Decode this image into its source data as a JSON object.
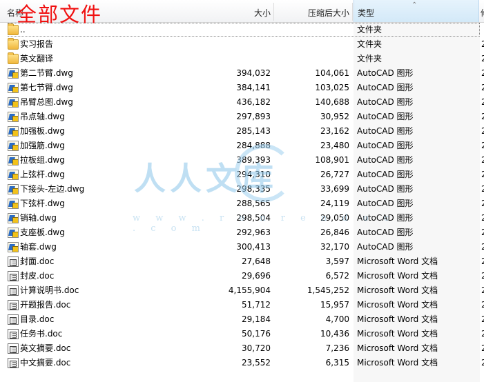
{
  "overlay_title": "全部文件",
  "columns": {
    "name": "名称",
    "size": "大小",
    "packed": "压缩后大小",
    "type": "类型",
    "more": "修"
  },
  "watermark": {
    "text": "人人文库",
    "url": "w w w . r e n r e n d o c . c o m"
  },
  "rows": [
    {
      "icon": "folder",
      "name": "..",
      "size": "",
      "packed": "",
      "type": "文件夹",
      "more": ""
    },
    {
      "icon": "folder",
      "name": "实习报告",
      "size": "",
      "packed": "",
      "type": "文件夹",
      "more": "2"
    },
    {
      "icon": "folder",
      "name": "英文翻译",
      "size": "",
      "packed": "",
      "type": "文件夹",
      "more": "2"
    },
    {
      "icon": "dwg",
      "name": "第二节臂.dwg",
      "size": "394,032",
      "packed": "104,061",
      "type": "AutoCAD 图形",
      "more": "2"
    },
    {
      "icon": "dwg",
      "name": "第七节臂.dwg",
      "size": "384,141",
      "packed": "103,025",
      "type": "AutoCAD 图形",
      "more": "2"
    },
    {
      "icon": "dwg",
      "name": "吊臂总图.dwg",
      "size": "436,182",
      "packed": "140,688",
      "type": "AutoCAD 图形",
      "more": "2"
    },
    {
      "icon": "dwg",
      "name": "吊点轴.dwg",
      "size": "297,893",
      "packed": "30,952",
      "type": "AutoCAD 图形",
      "more": "2"
    },
    {
      "icon": "dwg",
      "name": "加强板.dwg",
      "size": "285,143",
      "packed": "23,162",
      "type": "AutoCAD 图形",
      "more": "2"
    },
    {
      "icon": "dwg",
      "name": "加强筋.dwg",
      "size": "284,888",
      "packed": "23,480",
      "type": "AutoCAD 图形",
      "more": "2"
    },
    {
      "icon": "dwg",
      "name": "拉板组.dwg",
      "size": "389,393",
      "packed": "108,901",
      "type": "AutoCAD 图形",
      "more": "2"
    },
    {
      "icon": "dwg",
      "name": "上弦杆.dwg",
      "size": "294,310",
      "packed": "26,727",
      "type": "AutoCAD 图形",
      "more": "2"
    },
    {
      "icon": "dwg",
      "name": "下接头-左边.dwg",
      "size": "298,335",
      "packed": "33,699",
      "type": "AutoCAD 图形",
      "more": "2"
    },
    {
      "icon": "dwg",
      "name": "下弦杆.dwg",
      "size": "288,565",
      "packed": "24,119",
      "type": "AutoCAD 图形",
      "more": "2"
    },
    {
      "icon": "dwg",
      "name": "销轴.dwg",
      "size": "298,504",
      "packed": "29,050",
      "type": "AutoCAD 图形",
      "more": "2"
    },
    {
      "icon": "dwg",
      "name": "支座板.dwg",
      "size": "292,963",
      "packed": "26,846",
      "type": "AutoCAD 图形",
      "more": "2"
    },
    {
      "icon": "dwg",
      "name": "轴套.dwg",
      "size": "300,413",
      "packed": "32,170",
      "type": "AutoCAD 图形",
      "more": "2"
    },
    {
      "icon": "doc",
      "name": "封面.doc",
      "size": "27,648",
      "packed": "3,597",
      "type": "Microsoft Word 文档",
      "more": "2"
    },
    {
      "icon": "doc",
      "name": "封皮.doc",
      "size": "29,696",
      "packed": "6,572",
      "type": "Microsoft Word 文档",
      "more": "2"
    },
    {
      "icon": "doc",
      "name": "计算说明书.doc",
      "size": "4,155,904",
      "packed": "1,545,252",
      "type": "Microsoft Word 文档",
      "more": "2"
    },
    {
      "icon": "doc",
      "name": "开题报告.doc",
      "size": "51,712",
      "packed": "15,957",
      "type": "Microsoft Word 文档",
      "more": "2"
    },
    {
      "icon": "doc",
      "name": "目录.doc",
      "size": "29,184",
      "packed": "4,700",
      "type": "Microsoft Word 文档",
      "more": "2"
    },
    {
      "icon": "doc",
      "name": "任务书.doc",
      "size": "50,176",
      "packed": "10,436",
      "type": "Microsoft Word 文档",
      "more": "2"
    },
    {
      "icon": "doc",
      "name": "英文摘要.doc",
      "size": "30,720",
      "packed": "7,236",
      "type": "Microsoft Word 文档",
      "more": "2"
    },
    {
      "icon": "doc",
      "name": "中文摘要.doc",
      "size": "23,552",
      "packed": "6,315",
      "type": "Microsoft Word 文档",
      "more": "2"
    }
  ]
}
